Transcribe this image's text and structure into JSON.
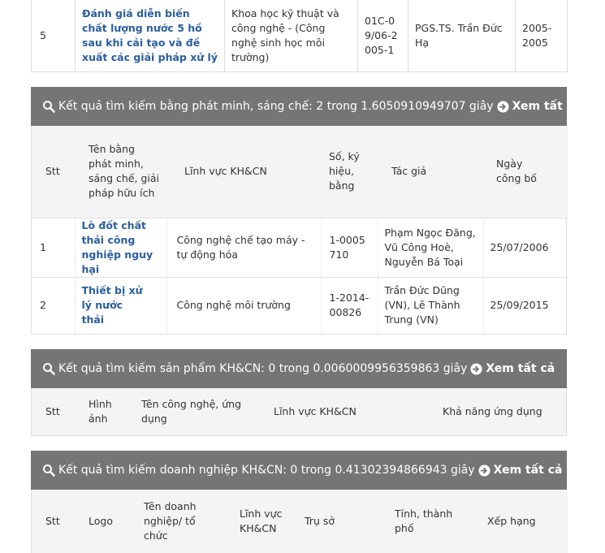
{
  "top_row": {
    "stt": "5",
    "title": "Đánh giá diễn biến chất lượng nước 5 hồ sau khi cải tạo và đề xuất các giải pháp xử lý",
    "field": "Khoa học kỹ thuật và công nghệ - (Công nghệ sinh học môi trường)",
    "code": "01C-09/06-2005-1",
    "author": "PGS.TS. Trần Đức Hạ",
    "years": "2005-2005"
  },
  "sections": {
    "patents": {
      "header_text": "Kết quả tìm kiếm bằng phát minh, sáng chế: 2 trong 1.6050910949707 giây",
      "view_all": "Xem tất cả",
      "columns": [
        "Stt",
        "Tên bằng phát minh, sáng chế, giải pháp hữu ích",
        "Lĩnh vực KH&CN",
        "Số, ký hiệu, bằng",
        "Tác giả",
        "Ngày công bố"
      ],
      "rows": [
        {
          "stt": "1",
          "name": "Lò đốt chất thải công nghiệp nguy hại",
          "field": "Công nghệ chế tạo máy - tự động hóa",
          "number": "1-0005710",
          "authors": "Phạm Ngọc Đăng, Vũ Công Hoè, Nguyễn Bá Toại",
          "date": "25/07/2006"
        },
        {
          "stt": "2",
          "name": "Thiết bị xử lý nước thải",
          "field": "Công nghệ môi trường",
          "number": "1-2014-00826",
          "authors": "Trần Đức Dũng (VN), Lê Thành Trung (VN)",
          "date": "25/09/2015"
        }
      ]
    },
    "products": {
      "header_text": "Kết quả tìm kiếm sản phẩm KH&CN: 0 trong 0.0060009956359863 giây",
      "view_all": "Xem tất cả",
      "columns": [
        "Stt",
        "Hình ảnh",
        "Tên công nghệ, ứng dụng",
        "Lĩnh vực KH&CN",
        "Khả năng ứng dụng"
      ]
    },
    "companies": {
      "header_text": "Kết quả tìm kiếm doanh nghiệp KH&CN: 0 trong 0.41302394866943 giây",
      "view_all": "Xem tất cả",
      "columns": [
        "Stt",
        "Logo",
        "Tên doanh nghiệp/ tổ chức",
        "Lĩnh vực KH&CN",
        "Trụ sở",
        "Tỉnh, thành phố",
        "Xếp hạng"
      ]
    }
  },
  "icons": {
    "search": "search-icon",
    "view_all": "arrow-circle-right-icon"
  },
  "colors": {
    "header_bg": "#757575",
    "link": "#2b5e9e",
    "thead_bg": "#f4f4f4"
  }
}
